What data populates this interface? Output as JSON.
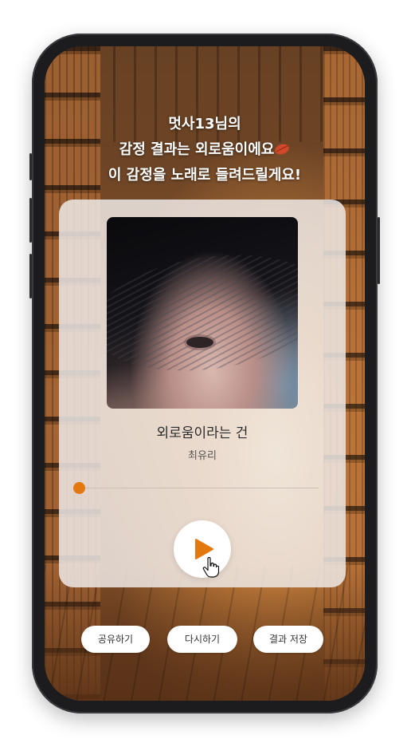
{
  "headline": {
    "line1": "멋사13님의",
    "line2": "감정 결과는 외로움이에요",
    "line3": "이 감정을 노래로 들려드릴게요!"
  },
  "emotion_icon": "leaf-icon",
  "song": {
    "title": "외로움이라는 건",
    "artist": "최유리",
    "progress": 0
  },
  "player": {
    "play_icon": "play-icon"
  },
  "actions": {
    "share": "공유하기",
    "retry": "다시하기",
    "save": "결과 저장"
  },
  "colors": {
    "accent": "#e3780e",
    "card": "#eee8e4"
  }
}
